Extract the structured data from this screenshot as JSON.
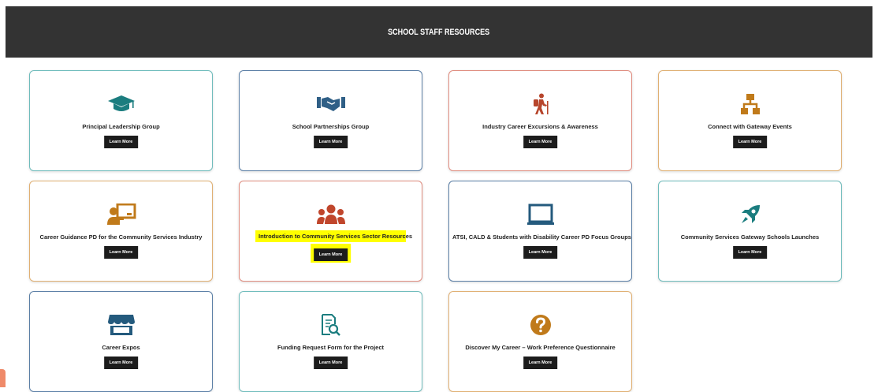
{
  "header": {
    "title": "SCHOOL STAFF RESOURCES"
  },
  "cards": [
    {
      "label": "Principal Leadership Group",
      "button": "Learn More",
      "icon": "graduation-cap-icon",
      "icon_color": "#1b7d7f",
      "border": "#6fbcbc"
    },
    {
      "label": "School Partnerships Group",
      "button": "Learn More",
      "icon": "handshake-icon",
      "icon_color": "#2f5f86",
      "border": "#5b7fa6"
    },
    {
      "label": "Industry Career Excursions & Awareness",
      "button": "Learn More",
      "icon": "hiking-icon",
      "icon_color": "#b7462c",
      "border": "#e08d80"
    },
    {
      "label": "Connect with Gateway Events",
      "button": "Learn More",
      "icon": "network-icon",
      "icon_color": "#c07a1a",
      "border": "#e0b073"
    },
    {
      "label": "Career Guidance PD for the Community Services Industry",
      "button": "Learn More",
      "icon": "teacher-icon",
      "icon_color": "#c07a1a",
      "border": "#e0b073"
    },
    {
      "label": "Introduction to Community Services Sector Resources",
      "button": "Learn More",
      "icon": "group-icon",
      "icon_color": "#c0462c",
      "border": "#e08d80"
    },
    {
      "label": "ATSI, CALD & Students with Disability Career PD Focus Groups",
      "button": "Learn More",
      "icon": "laptop-icon",
      "icon_color": "#245a7d",
      "border": "#5b7fa6"
    },
    {
      "label": "Community Services Gateway Schools Launches",
      "button": "Learn More",
      "icon": "rocket-icon",
      "icon_color": "#1b7d7f",
      "border": "#6fbcbc"
    },
    {
      "label": "Career Expos",
      "button": "Learn More",
      "icon": "store-icon",
      "icon_color": "#245a7d",
      "border": "#5b7fa6"
    },
    {
      "label": "Funding Request Form for the Project",
      "button": "Learn More",
      "icon": "document-search-icon",
      "icon_color": "#1b7d7f",
      "border": "#6fbcbc"
    },
    {
      "label": "Discover My Career – Work Preference Questionnaire",
      "button": "Learn More",
      "icon": "question-icon",
      "icon_color": "#c07a1a",
      "border": "#e0b073"
    }
  ],
  "colors": {
    "header_bg": "#333333",
    "button_bg": "#1c1c1c",
    "highlight": "#ffff00"
  }
}
